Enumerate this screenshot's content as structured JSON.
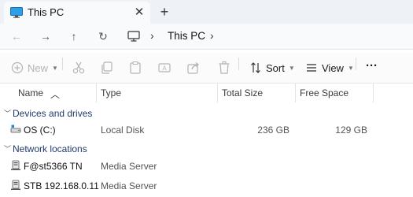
{
  "tab": {
    "title": "This PC",
    "close": "✕",
    "new_tab": "+"
  },
  "nav": {
    "back": "←",
    "forward": "→",
    "up": "↑",
    "refresh": "↻"
  },
  "breadcrumb": {
    "separator": "›",
    "location": "This PC",
    "end_chevron": "›"
  },
  "commands": {
    "new_label": "New",
    "sort_label": "Sort",
    "view_label": "View",
    "more_label": "···",
    "icons": [
      "cut-icon",
      "copy-icon",
      "paste-icon",
      "rename-icon",
      "share-icon",
      "delete-icon"
    ]
  },
  "columns": {
    "name": "Name",
    "type": "Type",
    "total_size": "Total Size",
    "free_space": "Free Space"
  },
  "groups": [
    {
      "label": "Devices and drives",
      "items": [
        {
          "name": "OS (C:)",
          "type": "Local Disk",
          "total_size": "236 GB",
          "free_space": "129 GB",
          "icon": "drive-icon"
        }
      ]
    },
    {
      "label": "Network locations",
      "items": [
        {
          "name": "F@st5366 TN",
          "type": "Media Server",
          "icon": "media-server-icon"
        },
        {
          "name": "STB 192.168.0.11",
          "type": "Media Server",
          "icon": "media-server-icon"
        }
      ]
    }
  ],
  "colors": {
    "accent": "#0067c0",
    "chrome": "#eef2f6",
    "group_label": "#1f3b6b"
  }
}
